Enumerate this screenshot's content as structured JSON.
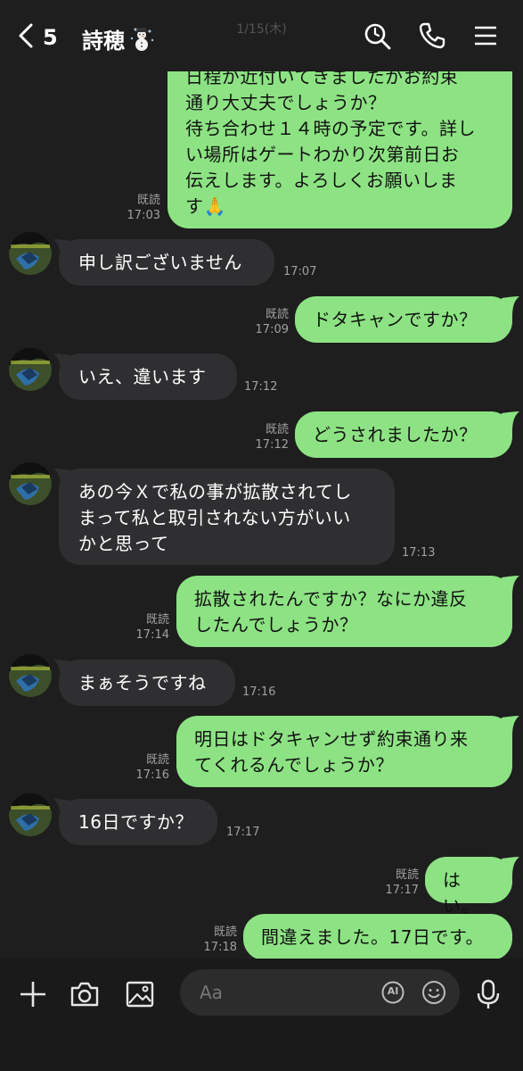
{
  "header": {
    "back_count": "5",
    "title": "詩穂",
    "date": "1/15(木)"
  },
  "messages": [
    {
      "side": "me",
      "lines": [
        "日程が近付いてきましたがお約束",
        "通り大丈夫でしょうか？",
        "待ち合わせ１４時の予定です。詳し",
        "い場所はゲートわかり次第前日お",
        "伝えします。よろしくお願いしま",
        "す🙏"
      ],
      "read": "既読",
      "time": "17:03"
    },
    {
      "side": "them",
      "lines": [
        "申し訳ございません"
      ],
      "time": "17:07"
    },
    {
      "side": "me",
      "lines": [
        "ドタキャンですか？"
      ],
      "read": "既読",
      "time": "17:09"
    },
    {
      "side": "them",
      "lines": [
        "いえ、違います"
      ],
      "time": "17:12"
    },
    {
      "side": "me",
      "lines": [
        "どうされましたか？"
      ],
      "read": "既読",
      "time": "17:12"
    },
    {
      "side": "them",
      "lines": [
        "あの今Ｘで私の事が拡散されてし",
        "まって私と取引されない方がいい",
        "かと思って"
      ],
      "time": "17:13"
    },
    {
      "side": "me",
      "lines": [
        "拡散されたんですか？なにか違反",
        "したんでしょうか？"
      ],
      "read": "既読",
      "time": "17:14"
    },
    {
      "side": "them",
      "lines": [
        "まぁそうですね"
      ],
      "time": "17:16"
    },
    {
      "side": "me",
      "lines": [
        "明日はドタキャンせず約束通り来",
        "てくれるんでしょうか？"
      ],
      "read": "既読",
      "time": "17:16"
    },
    {
      "side": "them",
      "lines": [
        "16日ですか？"
      ],
      "time": "17:17"
    },
    {
      "side": "me",
      "lines": [
        "はい。"
      ],
      "read": "既読",
      "time": "17:17"
    },
    {
      "side": "me",
      "lines": [
        "間違えました。17日です。"
      ],
      "read": "既読",
      "time": "17:18"
    }
  ],
  "input": {
    "placeholder": "Aa",
    "ai_label": "AI"
  },
  "icons": {
    "back": "chevron-left-icon",
    "search": "search-icon",
    "call": "phone-icon",
    "menu": "hamburger-menu-icon",
    "add": "plus-icon",
    "camera": "camera-icon",
    "gallery": "image-icon",
    "emoji": "emoji-icon",
    "mic": "microphone-icon"
  },
  "colors": {
    "background": "#1e1e1e",
    "my_bubble": "#8de383",
    "their_bubble": "#2f2f31"
  }
}
